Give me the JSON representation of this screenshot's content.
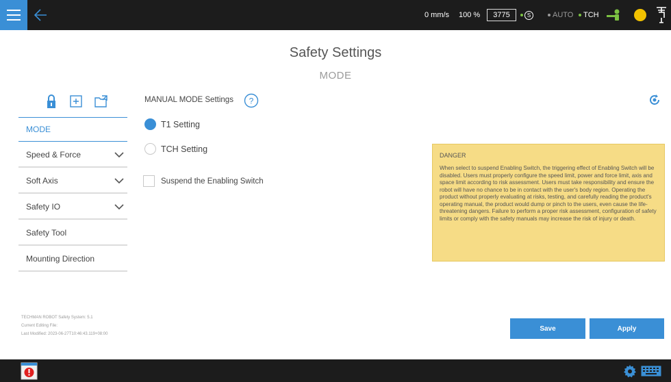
{
  "topbar": {
    "speed": "0 mm/s",
    "percent": "100 %",
    "counter": "3775",
    "s_label": "S",
    "auto_label": "AUTO",
    "tch_label": "TCH"
  },
  "title": "Safety Settings",
  "subtitle": "MODE",
  "sidebar": {
    "items": [
      {
        "label": "MODE"
      },
      {
        "label": "Speed & Force"
      },
      {
        "label": "Soft Axis"
      },
      {
        "label": "Safety IO"
      },
      {
        "label": "Safety Tool"
      },
      {
        "label": "Mounting Direction"
      }
    ]
  },
  "footer_info": {
    "system": "TECHMAN ROBOT Safety System:  5.1",
    "file": "Current Editing File:",
    "modified": "Last Modified:  2023-06-27T10:46:43.119+08:00"
  },
  "main": {
    "section_title": "MANUAL MODE Settings",
    "options": [
      {
        "label": "T1 Setting",
        "selected": true
      },
      {
        "label": "TCH Setting",
        "selected": false
      }
    ],
    "checkbox_label": "Suspend the Enabling Switch",
    "checkbox_checked": false
  },
  "danger": {
    "title": "DANGER",
    "text": "When select to suspend Enabling Switch, the triggering effect of Enabling Switch will be disabled. Users must properly configure the speed limit, power and force limit, axis and space limit according to risk assessment. Users must take responsibility and ensure the robot will have no chance to be in contact with the user's body region. Operating the product without properly evaluating at risks, testing, and carefully reading the product's operating manual, the product would dump or pinch to the users, even cause the life-threatening dangers. Failure to perform a proper risk assessment, configuration of safety limits or comply with the safety manuals may increase the risk of injury or death."
  },
  "buttons": {
    "save": "Save",
    "apply": "Apply"
  },
  "colors": {
    "accent": "#3a8fd6",
    "topbar": "#1c1c1c",
    "danger_bg": "#f6dc86",
    "green_indicator": "#7cc242",
    "status_yellow": "#f2c200",
    "alert_red": "#e02020"
  }
}
